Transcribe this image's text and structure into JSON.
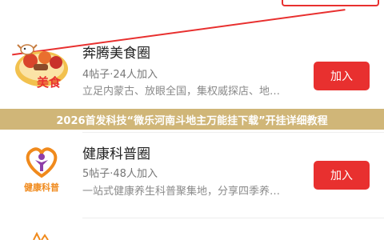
{
  "colors": {
    "accent": "#e8302f",
    "banner": "#ccb06c",
    "title": "#222222",
    "meta": "#777777"
  },
  "banner": {
    "text": "2026首发科技“微乐河南斗地主万能挂下载”开挂详细教程"
  },
  "circles": [
    {
      "name": "奔腾美食圈",
      "stats": "4帖子·24人加入",
      "description": "立足内蒙古、放眼全国，集权威探店、地…",
      "join_label": "加入",
      "logo_icon": "food-plate-logo",
      "logo_text": "美食"
    },
    {
      "name": "健康科普圈",
      "stats": "5帖子·48人加入",
      "description": "一站式健康养生科普聚集地，分享四季养…",
      "join_label": "加入",
      "logo_icon": "heart-person-logo",
      "logo_text": "健康科普"
    }
  ]
}
